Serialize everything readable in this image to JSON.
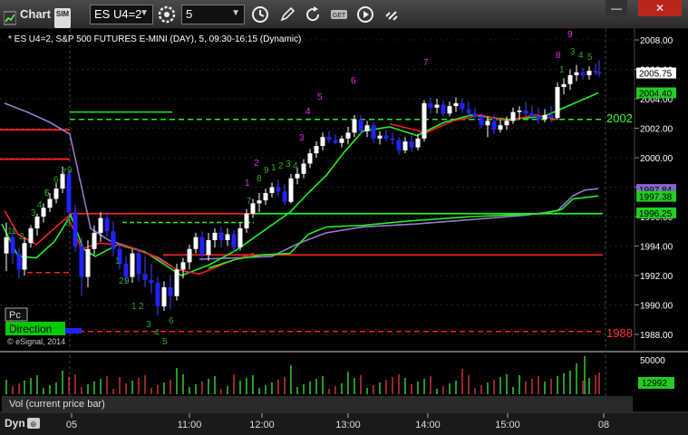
{
  "toolbar": {
    "title": "Chart",
    "sim_badge": "SIM",
    "symbol": "ES U4=2",
    "interval": "5",
    "icons": [
      "gear-icon",
      "clock-icon",
      "pencil-icon",
      "refresh-icon",
      "get-icon",
      "play-icon",
      "link-icon"
    ]
  },
  "window": {
    "minimize": "—",
    "close": "✕"
  },
  "chart_header": "* ES U4=2, S&P 500 FUTURES E-MINI (DAY), 5, 09:30-16:15 (Dynamic)",
  "price_axis": {
    "ticks": [
      "2008.00",
      "2006.00",
      "2004.00",
      "2002.00",
      "2000.00",
      "1998.00",
      "1996.00",
      "1994.00",
      "1992.00",
      "1990.00",
      "1988.00"
    ],
    "tick_values": [
      2008,
      2006,
      2004,
      2002,
      2000,
      1998,
      1996,
      1994,
      1992,
      1990,
      1988
    ],
    "badges": [
      {
        "label": "2005.75",
        "value": 2005.75,
        "bg": "#ffffff",
        "fg": "#000000"
      },
      {
        "label": "2004.40",
        "value": 2004.4,
        "bg": "#22cc22",
        "fg": "#000000"
      },
      {
        "label": "1997.84",
        "value": 1997.84,
        "bg": "#8866cc",
        "fg": "#000000"
      },
      {
        "label": "1997.38",
        "value": 1997.38,
        "bg": "#22cc22",
        "fg": "#000000"
      },
      {
        "label": "1996.25",
        "value": 1996.25,
        "bg": "#22cc22",
        "fg": "#000000"
      }
    ]
  },
  "level_labels": [
    {
      "label": "2002",
      "value": 2002.6,
      "color": "#33ff33"
    },
    {
      "label": "1988",
      "value": 1988.2,
      "color": "#ff3333"
    }
  ],
  "time_axis": [
    "05",
    "11:00",
    "12:00",
    "13:00",
    "14:00",
    "15:00",
    "08"
  ],
  "pc_label": "Pc",
  "direction_label": "Direction",
  "copyright": "© eSignal, 2014",
  "volume": {
    "label": "Vol (current price bar)",
    "ticks": [
      "50000"
    ],
    "current": "12992"
  },
  "dyn_label": "Dyn",
  "colors": {
    "up_candle": "#ffffff",
    "down_candle": "#2222ff",
    "green_line": "#22ee22",
    "red_line": "#ee2222",
    "purple_line": "#9977cc",
    "count_green": "#22aa22",
    "count_magenta": "#ee22ee"
  },
  "chart_data": {
    "type": "candlestick",
    "ylim": [
      1987.5,
      2009
    ],
    "x_labels": [
      "05",
      "11:00",
      "12:00",
      "13:00",
      "14:00",
      "15:00",
      "08"
    ],
    "levels": [
      {
        "value": 2002.6,
        "style": "dashed",
        "color": "#22ee22"
      },
      {
        "value": 1988.2,
        "style": "dashed",
        "color": "#ee2222"
      },
      {
        "value": 1996.2,
        "style": "solid",
        "color": "#22ee22"
      },
      {
        "value": 1993.4,
        "style": "solid",
        "color": "#ee2222"
      }
    ],
    "counts_green": [
      "1",
      "2",
      "3",
      "4",
      "5",
      "6",
      "7",
      "8",
      "9",
      "1",
      "2",
      "3",
      "4",
      "5",
      "6",
      "7",
      "8",
      "9",
      "1",
      "2",
      "3",
      "4",
      "5",
      "6",
      "7",
      "8",
      "9",
      "1",
      "2",
      "3",
      "4",
      "5",
      "6"
    ],
    "counts_magenta": [
      "1",
      "2",
      "3",
      "4",
      "5",
      "6",
      "7",
      "8",
      "9"
    ]
  }
}
